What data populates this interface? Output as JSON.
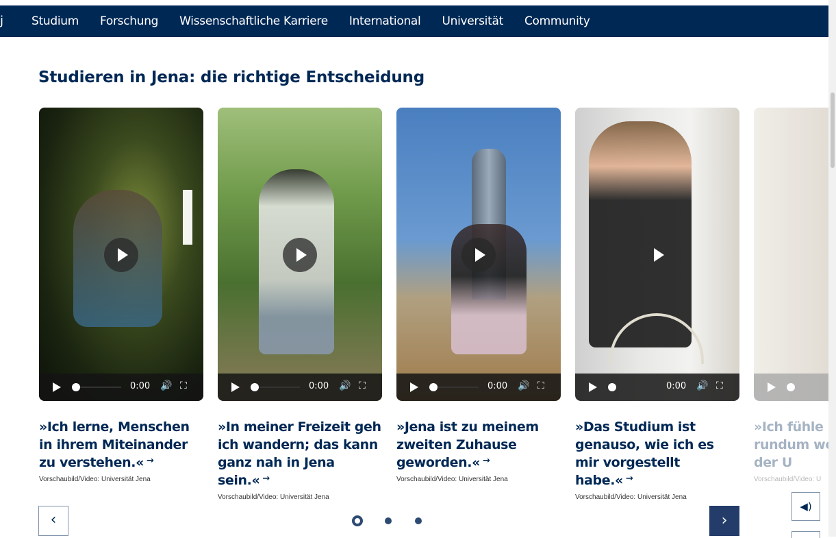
{
  "nav": {
    "logo": "j",
    "items": [
      "Studium",
      "Forschung",
      "Wissenschaftliche Karriere",
      "International",
      "Universität",
      "Community"
    ]
  },
  "section": {
    "heading": "Studieren in Jena: die richtige Entscheidung"
  },
  "cards": [
    {
      "quote": "»Ich lerne, Menschen in ihrem Miteinander zu verstehen.«",
      "credit": "Vorschaubild/Video: Universität Jena",
      "time": "0:00"
    },
    {
      "quote": "»In meiner Freizeit geh ich wandern; das kann ganz nah in Jena sein.«",
      "credit": "Vorschaubild/Video: Universität Jena",
      "time": "0:00"
    },
    {
      "quote": "»Jena ist zu meinem zweiten Zuhause geworden.«",
      "credit": "Vorschaubild/Video: Universität Jena",
      "time": "0:00"
    },
    {
      "quote": "»Das Studium ist genauso, wie ich es mir vorgestellt habe.«",
      "credit": "Vorschaubild/Video: Universität Jena",
      "time": "0:00"
    },
    {
      "quote": "»Ich fühle mich rundum wohl und an der U",
      "credit": "Vorschaubild/Video: U",
      "time": ""
    }
  ],
  "icons": {
    "arrow": "→",
    "prev": "‹",
    "next": "›",
    "volume": "🔊",
    "fullscreen": "⛶",
    "sound_toggle": "◀)"
  },
  "colors": {
    "primary": "#002855",
    "pager_next": "#233c6a"
  },
  "pager": {
    "active_index": 0,
    "count": 3
  }
}
